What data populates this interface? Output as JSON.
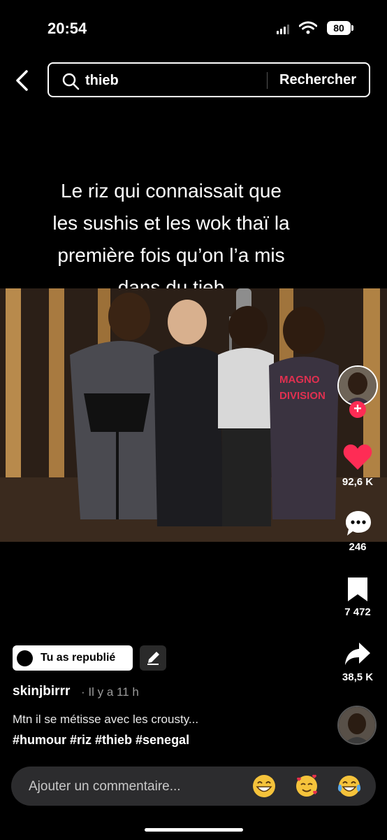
{
  "status_bar": {
    "time": "20:54",
    "battery": "80"
  },
  "search": {
    "query": "thieb",
    "button_label": "Rechercher"
  },
  "caption": {
    "lines": [
      "Le riz qui connaissait que",
      "les sushis et les wok thaï la",
      "première fois qu’on l’a mis",
      "dans du tieb"
    ]
  },
  "video": {
    "shirt_text_line1": "MAGNO",
    "shirt_text_line2": "DIVISION"
  },
  "actions": {
    "likes": "92,6 K",
    "comments": "246",
    "saves": "7 472",
    "shares": "38,5 K"
  },
  "post": {
    "repost_label": "Tu as republié",
    "username": "skinjbirrr",
    "time_ago": "· Il y a 11 h",
    "description": "Mtn il se métisse avec les crousty...",
    "hashtags": "#humour #riz #thieb #senegal"
  },
  "comment": {
    "placeholder": "Ajouter un commentaire..."
  },
  "colors": {
    "accent_red": "#fe2c55",
    "background": "#000000"
  },
  "icons": [
    "chevron-left-icon",
    "search-icon",
    "heart-icon",
    "comment-bubble-icon",
    "bookmark-icon",
    "share-arrow-icon",
    "pencil-icon",
    "plus-icon"
  ]
}
